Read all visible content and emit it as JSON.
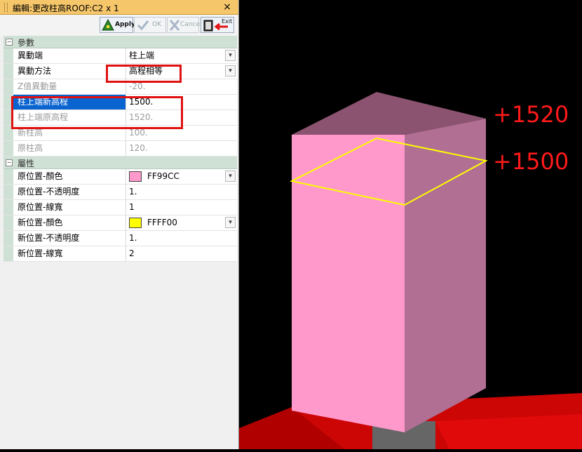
{
  "window": {
    "title": "編輯:更改柱高ROOF:C2 x 1",
    "close_label": "×"
  },
  "toolbar": {
    "apply_label": "Apply",
    "ok_label": "OK",
    "cancel_label": "Cancel",
    "exit_label": "Exit"
  },
  "grid": {
    "category_params": "參數",
    "category_props": "屬性",
    "rows": {
      "move_end": {
        "name": "異動端",
        "value": "柱上端"
      },
      "move_method": {
        "name": "異動方法",
        "value": "高程相等"
      },
      "z_delta": {
        "name": "Z值異動量",
        "value": "-20."
      },
      "new_top_elev": {
        "name": "柱上端新高程",
        "value": "1500."
      },
      "orig_top_elev": {
        "name": "柱上端原高程",
        "value": "1520."
      },
      "new_height": {
        "name": "新柱高",
        "value": "100."
      },
      "orig_height": {
        "name": "原柱高",
        "value": "120."
      },
      "orig_color": {
        "name": "原位置-顏色",
        "value": "FF99CC",
        "swatch": "#FF99CC"
      },
      "orig_opacity": {
        "name": "原位置-不透明度",
        "value": "1."
      },
      "orig_linewidth": {
        "name": "原位置-線寬",
        "value": "1"
      },
      "new_color": {
        "name": "新位置-顏色",
        "value": "FFFF00",
        "swatch": "#FFFF00"
      },
      "new_opacity": {
        "name": "新位置-不透明度",
        "value": "1."
      },
      "new_linewidth": {
        "name": "新位置-線寬",
        "value": "2"
      }
    }
  },
  "scene": {
    "label_top": "+1520",
    "label_new": "+1500",
    "column_color": "#FF99CC",
    "outline_color": "#FFFF00",
    "annotation_color": "#FF1A1A"
  }
}
